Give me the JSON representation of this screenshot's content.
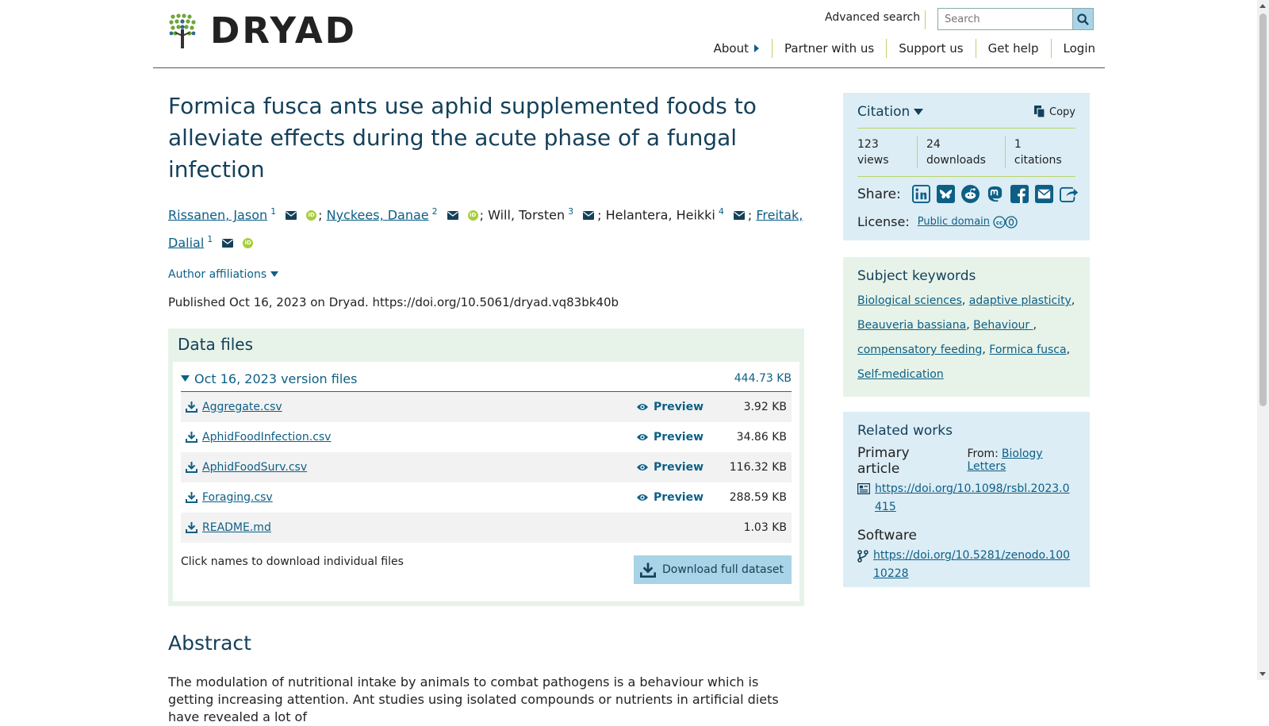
{
  "header": {
    "logo_text": "DRYAD",
    "advanced_search": "Advanced search",
    "search_placeholder": "Search",
    "nav": [
      "About",
      "Partner with us",
      "Support us",
      "Get help",
      "Login"
    ]
  },
  "dataset": {
    "title": "Formica fusca ants use aphid supplemented foods to alleviate effects during the acute phase of a fungal infection",
    "authors": [
      {
        "name": "Rissanen, Jason",
        "affil": "1",
        "linked": true,
        "orcid": true
      },
      {
        "name": "Nyckees, Danae",
        "affil": "2",
        "linked": true,
        "orcid": true
      },
      {
        "name": "Will, Torsten",
        "affil": "3",
        "linked": false,
        "orcid": false
      },
      {
        "name": "Helantera, Heikki",
        "affil": "4",
        "linked": false,
        "orcid": false
      },
      {
        "name": "Freitak, Dalial",
        "affil": "1",
        "linked": true,
        "orcid": true
      }
    ],
    "author_affiliations_label": "Author affiliations",
    "published_line": "Published Oct 16, 2023 on Dryad. https://doi.org/10.5061/dryad.vq83bk40b"
  },
  "data_files": {
    "heading": "Data files",
    "version_label": "Oct 16, 2023 version files",
    "version_size": "444.73 KB",
    "preview_label": "Preview",
    "files": [
      {
        "name": "Aggregate.csv",
        "size": "3.92 KB",
        "preview": true
      },
      {
        "name": "AphidFoodInfection.csv",
        "size": "34.86 KB",
        "preview": true
      },
      {
        "name": "AphidFoodSurv.csv",
        "size": "116.32 KB",
        "preview": true
      },
      {
        "name": "Foraging.csv",
        "size": "288.59 KB",
        "preview": true
      },
      {
        "name": "README.md",
        "size": "1.03 KB",
        "preview": false
      }
    ],
    "footer_text": "Click names to download individual files",
    "download_button": "Download full dataset"
  },
  "abstract": {
    "heading": "Abstract",
    "text": "The modulation of nutritional intake by animals to combat pathogens is a behaviour which is getting increasing attention. Ant studies using isolated compounds or nutrients in artificial diets have revealed a lot of"
  },
  "citation": {
    "title": "Citation",
    "copy_label": "Copy",
    "stats": [
      "123 views",
      "24 downloads",
      "1 citations"
    ],
    "share_label": "Share:",
    "share_icons": [
      "linkedin-icon",
      "bluesky-icon",
      "reddit-icon",
      "mastodon-icon",
      "facebook-icon",
      "email-icon",
      "share-icon"
    ],
    "license_label": "License:",
    "license_link": "Public domain"
  },
  "keywords": {
    "title": "Subject keywords",
    "items": [
      "Biological sciences",
      "adaptive plasticity",
      "Beauveria bassiana",
      "Behaviour ",
      "compensatory feeding",
      "Formica fusca",
      "Self-medication"
    ]
  },
  "related": {
    "title": "Related works",
    "primary_label": "Primary article",
    "from_label": "From:",
    "from_link": "Biology Letters",
    "primary_link": "https://doi.org/10.1098/rsbl.2023.0415",
    "software_label": "Software",
    "software_link": "https://doi.org/10.5281/zenodo.10010228"
  },
  "colors": {
    "link": "#0d5f86",
    "heading": "#14405a",
    "accent_green": "#b9d56a",
    "panel_blue": "#dcedf5",
    "panel_green": "#e7f3e9",
    "button_blue": "#a9d3e6"
  }
}
